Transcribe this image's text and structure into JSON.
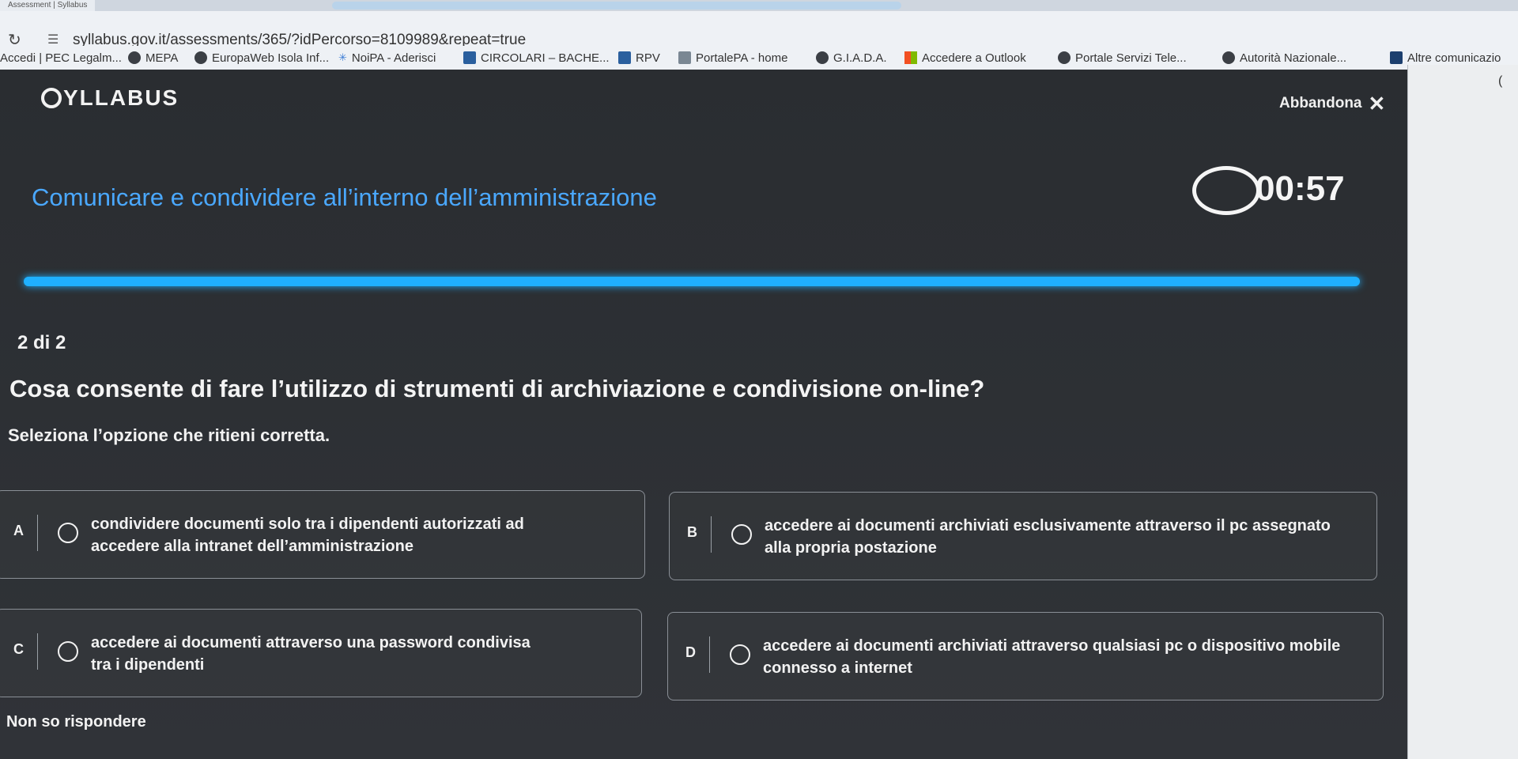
{
  "browser": {
    "tab_title": "Assessment | Syllabus",
    "url": "syllabus.gov.it/assessments/365/?idPercorso=8109989&repeat=true",
    "bookmarks": [
      {
        "label": "Accedi | PEC Legalm...",
        "icon": "none"
      },
      {
        "label": "MEPA",
        "icon": "globe-icon"
      },
      {
        "label": "EuropaWeb Isola Inf...",
        "icon": "globe-icon"
      },
      {
        "label": "NoiPA - Aderisci",
        "icon": "star-icon"
      },
      {
        "label": "CIRCOLARI – BACHE...",
        "icon": "page-icon"
      },
      {
        "label": "RPV",
        "icon": "page-icon"
      },
      {
        "label": "PortalePA - home",
        "icon": "page-icon"
      },
      {
        "label": "G.I.A.D.A.",
        "icon": "globe-icon"
      },
      {
        "label": "Accedere a Outlook",
        "icon": "windows-icon"
      },
      {
        "label": "Portale Servizi Tele...",
        "icon": "globe-icon"
      },
      {
        "label": "Autorità Nazionale...",
        "icon": "globe-icon"
      },
      {
        "label": "Altre comunicazio",
        "icon": "page-icon"
      }
    ]
  },
  "app": {
    "logo": "YLLABUS",
    "abandon_label": "Abbandona",
    "course_title": "Comunicare e condividere all’interno dell’amministrazione",
    "timer": "00:57",
    "progress": 1.0,
    "progress_color": "#1fb0ff",
    "question_counter": "2 di 2",
    "question": "Cosa consente di fare l’utilizzo di strumenti di archiviazione e condivisione on-line?",
    "instruction": "Seleziona l’opzione che ritieni corretta.",
    "options": [
      {
        "letter": "A",
        "text": "condividere documenti solo tra i dipendenti autorizzati ad accedere alla intranet dell’amministrazione"
      },
      {
        "letter": "B",
        "text": "accedere ai documenti archiviati esclusivamente attraverso il pc assegnato alla propria postazione"
      },
      {
        "letter": "C",
        "text": "accedere ai documenti attraverso una password condivisa tra i dipendenti"
      },
      {
        "letter": "D",
        "text": "accedere ai documenti archiviati attraverso qualsiasi pc o dispositivo mobile connesso a internet"
      }
    ],
    "skip_label": "Non so rispondere",
    "title_color": "#4aa8ff"
  }
}
